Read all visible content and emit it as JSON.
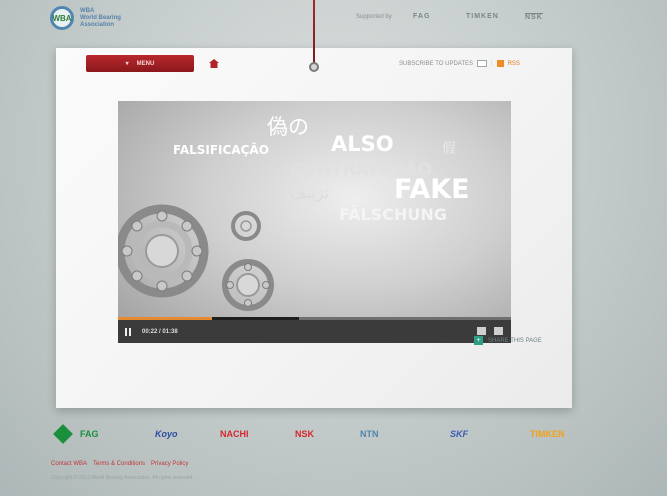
{
  "header": {
    "logo_mark": "WBA",
    "logo_lines": [
      "WBA",
      "World Bearing",
      "Association"
    ],
    "supported_by": "Supported by",
    "brands_top": [
      "FAG",
      "TIMKEN",
      "NSK"
    ]
  },
  "nav": {
    "menu_label": "MENU",
    "subscribe_label": "SUBSCRIBE TO UPDATES",
    "rss_label": "RSS"
  },
  "video": {
    "words": [
      "偽の",
      "FALSIFICAÇÃO",
      "ALSO",
      "假",
      "CONTRAFAÇÃO",
      "تزييف",
      "FAKE",
      "FÄLSCHUNG"
    ],
    "time": "00:22 / 01:38",
    "progress_fraction": 0.24,
    "loaded_fraction": 0.46
  },
  "share": {
    "label": "SHARE THIS PAGE"
  },
  "footer": {
    "brands": [
      "FAG",
      "Koyo",
      "NACHI",
      "NSK",
      "NTN",
      "SKF",
      "TIMKEN"
    ],
    "brand_colors": [
      "#1a8f3c",
      "#2a4ea0",
      "#d8262e",
      "#d8262e",
      "#4f86b0",
      "#3c5ab0",
      "#f0a21a"
    ],
    "links": [
      "Contact WBA",
      "Terms & Conditions",
      "Privacy Policy"
    ],
    "copyright": "Copyright © 2013 World Bearing Association. All rights reserved."
  },
  "colors": {
    "accent_red": "#b1252a",
    "progress_orange": "#e58a2e",
    "share_green": "#2b9e84"
  }
}
